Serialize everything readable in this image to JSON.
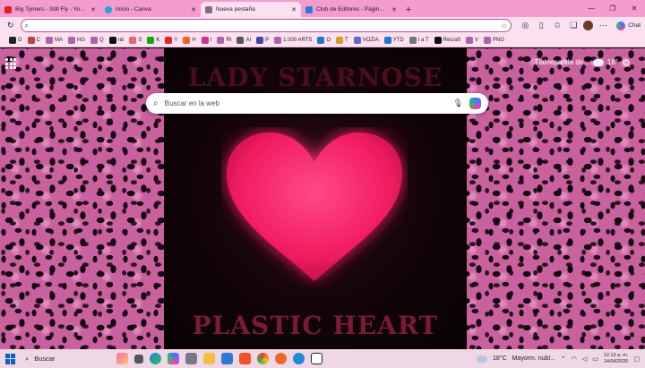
{
  "tabs": [
    {
      "title": "Big Tymers - Still Fly - YouTube",
      "fav_color": "#e02020",
      "active": false
    },
    {
      "title": "Inicio - Canva",
      "fav_color": "#1fa5d6",
      "active": false
    },
    {
      "title": "Nueva pestaña",
      "fav_color": "#8a6a80",
      "active": true
    },
    {
      "title": "Club de Editores - Páginas útiles",
      "fav_color": "#2a7bd6",
      "active": false
    }
  ],
  "omnibox": {
    "value": "",
    "placeholder": ""
  },
  "toolbar": {
    "chat_label": "Chat"
  },
  "bookmarks": [
    {
      "label": "G",
      "color": "#222"
    },
    {
      "label": "C",
      "color": "#b44"
    },
    {
      "label": "MA",
      "color": "#a6a"
    },
    {
      "label": "HG",
      "color": "#a6a"
    },
    {
      "label": "Q",
      "color": "#a6a"
    },
    {
      "label": "nb",
      "color": "#111"
    },
    {
      "label": "S",
      "color": "#e66"
    },
    {
      "label": "K",
      "color": "#1a1"
    },
    {
      "label": "Y",
      "color": "#e22"
    },
    {
      "label": "H",
      "color": "#e62"
    },
    {
      "label": "I",
      "color": "#c38"
    },
    {
      "label": "RI",
      "color": "#a6a"
    },
    {
      "label": "AI",
      "color": "#555"
    },
    {
      "label": "P",
      "color": "#44a"
    },
    {
      "label": "1.000 ARTS",
      "color": "#a6a"
    },
    {
      "label": "O",
      "color": "#27c"
    },
    {
      "label": "T",
      "color": "#d92"
    },
    {
      "label": "VOZIA",
      "color": "#66c"
    },
    {
      "label": "YTD",
      "color": "#27c"
    },
    {
      "label": "I a T",
      "color": "#777"
    },
    {
      "label": "Recraft",
      "color": "#111"
    },
    {
      "label": "V",
      "color": "#a6a"
    },
    {
      "label": "PNG",
      "color": "#a6a"
    }
  ],
  "search": {
    "placeholder": "Buscar en la web"
  },
  "album": {
    "title_top": "LADY STARNOSE",
    "title_bottom": "PLASTIC HEART"
  },
  "weather": {
    "location": "Tlalnepantla de...",
    "temp": "18°"
  },
  "taskbar": {
    "search_label": "Buscar",
    "weather_temp": "18°C",
    "weather_desc": "Mayorm. nubl...",
    "time": "12:13 a. m.",
    "date": "14/04/2026"
  }
}
